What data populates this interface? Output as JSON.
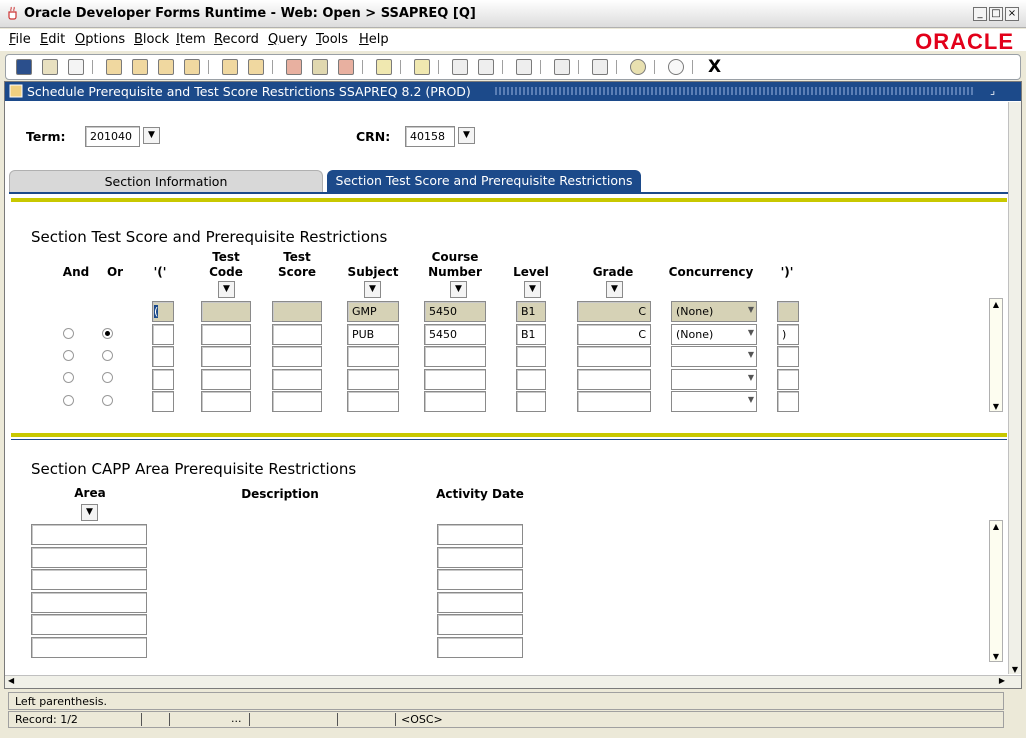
{
  "window": {
    "title": "Oracle Developer Forms Runtime - Web:  Open > SSAPREQ [Q]"
  },
  "menu": [
    {
      "label": "File",
      "u": "F",
      "rest": "ile"
    },
    {
      "label": "Edit",
      "u": "E",
      "rest": "dit"
    },
    {
      "label": "Options",
      "u": "O",
      "rest": "ptions"
    },
    {
      "label": "Block",
      "u": "B",
      "rest": "lock"
    },
    {
      "label": "Item",
      "u": "I",
      "rest": "tem"
    },
    {
      "label": "Record",
      "u": "R",
      "rest": "ecord"
    },
    {
      "label": "Query",
      "u": "Q",
      "rest": "uery"
    },
    {
      "label": "Tools",
      "u": "T",
      "rest": "ools"
    },
    {
      "label": "Help",
      "u": "H",
      "rest": "elp"
    }
  ],
  "brand": {
    "logo": "ORACLE",
    "color": "#e2001a"
  },
  "toolbar": {
    "exit_label": "X"
  },
  "form": {
    "caption": "Schedule Prerequisite and Test Score Restrictions  SSAPREQ  8.2  (PROD)",
    "term_label": "Term:",
    "term_value": "201040",
    "crn_label": "CRN:",
    "crn_value": "40158"
  },
  "tabs": {
    "section_info": "Section Information",
    "section_test": "Section Test Score and Prerequisite Restrictions"
  },
  "test_section": {
    "title": "Section Test Score and Prerequisite Restrictions",
    "headers": {
      "and": "And",
      "or": "Or",
      "lparen": "'('",
      "test_code_1": "Test",
      "test_code_2": "Code",
      "test_score_1": "Test",
      "test_score_2": "Score",
      "subject": "Subject",
      "course_1": "Course",
      "course_2": "Number",
      "level": "Level",
      "grade": "Grade",
      "concurrency": "Concurrency",
      "rparen": "')'"
    },
    "rows": [
      {
        "lparen": "(",
        "subject": "GMP",
        "course": "5450",
        "level": "B1",
        "grade": "C",
        "concurrency": "(None)",
        "rparen": ""
      },
      {
        "lparen": "",
        "subject": "PUB",
        "course": "5450",
        "level": "B1",
        "grade": "C",
        "concurrency": "(None)",
        "rparen": ")"
      }
    ]
  },
  "capp_section": {
    "title": "Section CAPP Area Prerequisite Restrictions",
    "headers": {
      "area": "Area",
      "description": "Description",
      "activity_date": "Activity Date"
    }
  },
  "status": {
    "message": "Left parenthesis.",
    "record": "Record: 1/2",
    "ellipsis": "...",
    "osc": "<OSC>"
  }
}
